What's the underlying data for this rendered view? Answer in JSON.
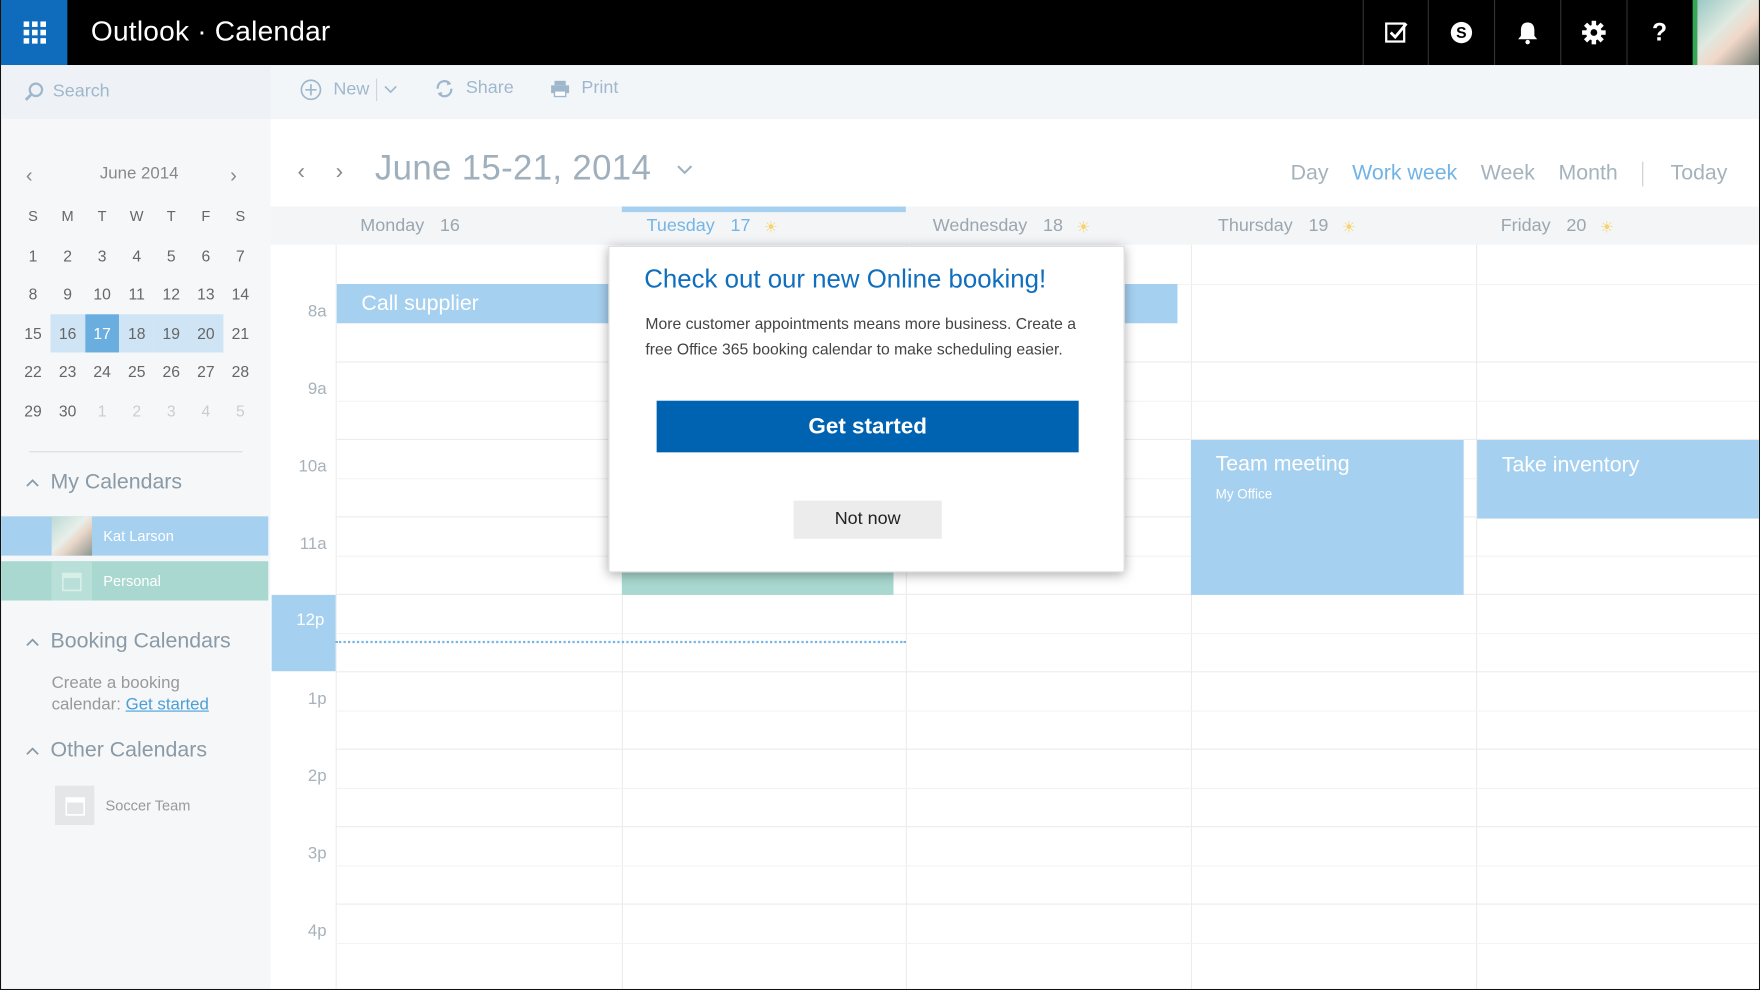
{
  "app": {
    "title": "Outlook · Calendar"
  },
  "topbar": {
    "icons": [
      "waffle-icon",
      "todo-check-icon",
      "skype-icon",
      "bell-icon",
      "gear-icon",
      "help-icon"
    ],
    "help_glyph": "?"
  },
  "command_bar": {
    "search_placeholder": "Search",
    "new_label": "New",
    "share_label": "Share",
    "print_label": "Print"
  },
  "mini_calendar": {
    "month_label": "June 2014",
    "dow": [
      "S",
      "M",
      "T",
      "W",
      "T",
      "F",
      "S"
    ],
    "weeks": [
      [
        "1",
        "2",
        "3",
        "4",
        "5",
        "6",
        "7"
      ],
      [
        "8",
        "9",
        "10",
        "11",
        "12",
        "13",
        "14"
      ],
      [
        "15",
        "16",
        "17",
        "18",
        "19",
        "20",
        "21"
      ],
      [
        "22",
        "23",
        "24",
        "25",
        "26",
        "27",
        "28"
      ],
      [
        "29",
        "30",
        "1",
        "2",
        "3",
        "4",
        "5"
      ]
    ],
    "selected_week": 2,
    "today_index": 2
  },
  "sidebar": {
    "my_calendars_label": "My Calendars",
    "calendars": [
      {
        "label": "Kat Larson",
        "color": "#a6d0f0"
      },
      {
        "label": "Personal",
        "color": "#a8d8cf"
      }
    ],
    "booking_calendars_label": "Booking Calendars",
    "booking_text": "Create a booking calendar:",
    "booking_link": "Get started",
    "other_calendars_label": "Other Calendars",
    "other_calendars": [
      {
        "label": "Soccer Team"
      }
    ]
  },
  "calendar": {
    "date_range": "June 15-21, 2014",
    "views": [
      {
        "label": "Day",
        "active": false
      },
      {
        "label": "Work week",
        "active": true
      },
      {
        "label": "Week",
        "active": false
      },
      {
        "label": "Month",
        "active": false
      }
    ],
    "today_label": "Today",
    "days": [
      {
        "name": "Monday",
        "num": "16",
        "sunny": false
      },
      {
        "name": "Tuesday",
        "num": "17",
        "sunny": true,
        "today": true
      },
      {
        "name": "Wednesday",
        "num": "18",
        "sunny": true
      },
      {
        "name": "Thursday",
        "num": "19",
        "sunny": true
      },
      {
        "name": "Friday",
        "num": "20",
        "sunny": true
      }
    ],
    "times": [
      "8a",
      "9a",
      "10a",
      "11a",
      "12p",
      "1p",
      "2p",
      "3p",
      "4p"
    ],
    "current_time_label": "12p",
    "events": [
      {
        "title": "Call supplier",
        "day": "Monday"
      },
      {
        "title": "Team meeting",
        "subtitle": "My Office",
        "day": "Thursday"
      },
      {
        "title": "Take inventory",
        "day": "Friday"
      }
    ]
  },
  "modal": {
    "title": "Check out our new Online booking!",
    "body": "More customer appointments means more business. Create a free Office 365 booking calendar to make scheduling easier.",
    "primary_label": "Get started",
    "secondary_label": "Not now"
  },
  "colors": {
    "accent": "#0063b1",
    "event_blue": "#a6d0f0",
    "event_green": "#a8d8cf",
    "waffle_bg": "#0f6cbd"
  }
}
